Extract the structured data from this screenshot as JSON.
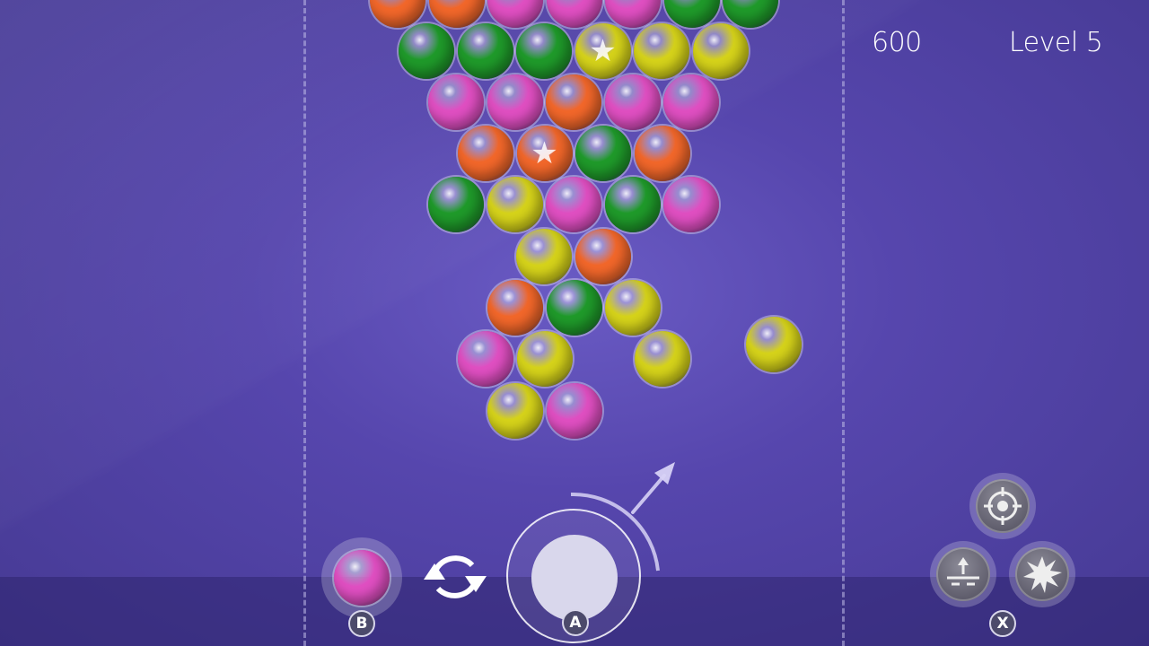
{
  "hud": {
    "score": "600",
    "level": "Level 5"
  },
  "controls": {
    "swap_key": "B",
    "fire_key": "A",
    "powerup_key": "X",
    "next_bubble_color": "magenta",
    "icons": [
      "swap-arrows-icon",
      "crosshair-icon",
      "row-push-icon",
      "explosion-icon",
      "aim-arrow-icon"
    ]
  },
  "colors": {
    "orange": "#f2672a",
    "magenta": "#e04fc2",
    "green": "#1f9a2a",
    "yellow": "#d6d31a",
    "background": "#5646ad"
  },
  "board": {
    "rows": [
      [
        "orange",
        "orange",
        "magenta",
        "magenta",
        "magenta",
        "green",
        "green"
      ],
      [
        "green",
        "green",
        "green",
        "yellow-star",
        "yellow",
        "yellow"
      ],
      [
        "magenta",
        "magenta",
        "orange",
        "magenta",
        "magenta"
      ],
      [
        "orange",
        "orange-star",
        "green",
        "orange"
      ],
      [
        "green",
        "yellow",
        "magenta",
        "green",
        "magenta"
      ],
      [
        "yellow",
        "orange"
      ],
      [
        "orange",
        "green",
        "yellow"
      ],
      [
        "magenta",
        "yellow",
        "",
        "yellow"
      ],
      [
        "yellow",
        "magenta"
      ]
    ]
  },
  "flying_bubble": "yellow"
}
